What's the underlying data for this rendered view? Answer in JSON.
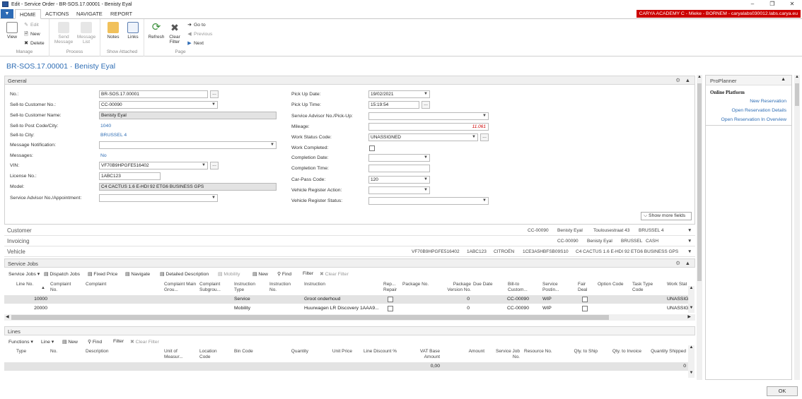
{
  "window": {
    "title": "Edit - Service Order - BR-SOS.17.00001 - Benisty Eyal"
  },
  "ribbon_tabs": [
    "HOME",
    "ACTIONS",
    "NAVIGATE",
    "REPORT"
  ],
  "company": "CARYA ACADEMY C - Mieke - BORNEM - caryalabs030012.labs.carya.eu",
  "ribbon": {
    "manage": {
      "label": "Manage",
      "view": "View",
      "edit": "Edit",
      "new": "New",
      "delete": "Delete"
    },
    "process": {
      "label": "Process",
      "send_message": "Send\nMessage",
      "message_list": "Message\nList"
    },
    "attached": {
      "label": "Show Attached",
      "notes": "Notes",
      "links": "Links"
    },
    "page": {
      "label": "Page",
      "refresh": "Refresh",
      "clear_filter": "Clear\nFilter",
      "goto": "Go to",
      "previous": "Previous",
      "next": "Next"
    }
  },
  "page_title": "BR-SOS.17.00001 · Benisty Eyal",
  "general": {
    "title": "General",
    "no_label": "No.:",
    "no": "BR-SOS.17.00001",
    "cust_no_label": "Sell-to Customer No.:",
    "cust_no": "CC-00090",
    "cust_name_label": "Sell-to Customer Name:",
    "cust_name": "Benisty Eyal",
    "post_label": "Sell-to Post Code/City:",
    "post": "1040",
    "city_label": "Sell-to City:",
    "city": "BRUSSEL 4",
    "msg_notif_label": "Message Notification:",
    "messages_label": "Messages:",
    "messages": "No",
    "vin_label": "VIN:",
    "vin": "VF70B9HPGFE516402",
    "license_label": "License No.:",
    "license": "1ABC123",
    "model_label": "Model:",
    "model": "C4 CACTUS 1.6 E-HDI 92 ETG6 BUSINESS  GPS",
    "sa_appt_label": "Service Advisor No./Appointment:",
    "pickup_date_label": "Pick Up Date:",
    "pickup_date": "19/02/2021",
    "pickup_time_label": "Pick Up Time:",
    "pickup_time": "15:19:54",
    "sa_pickup_label": "Service Advisor No./Pick-Up:",
    "mileage_label": "Mileage:",
    "mileage": "11.061",
    "work_status_label": "Work Status Code:",
    "work_status": "UNASSIGNED",
    "work_completed_label": "Work Completed:",
    "completion_date_label": "Completion Date:",
    "completion_time_label": "Completion Time:",
    "carpass_label": "Car-Pass Code:",
    "carpass": "120",
    "vr_action_label": "Vehicle Register Action:",
    "vr_status_label": "Vehicle Register Status:",
    "show_more": "Show more fields"
  },
  "fasttabs": {
    "customer": {
      "name": "Customer",
      "summary": [
        "CC-00090",
        "Benisty Eyal",
        "Toulousestraat 43",
        "BRUSSEL 4"
      ]
    },
    "invoicing": {
      "name": "Invoicing",
      "summary": [
        "CC-00090",
        "Benisty Eyal",
        "BRUSSEL",
        "CASH"
      ]
    },
    "vehicle": {
      "name": "Vehicle",
      "summary": [
        "VF70B9HPGFE516402",
        "1ABC123",
        "CITROËN",
        "1CE3A5HBFSB09S10",
        "C4 CACTUS 1.6 E-HDI 92 ETG6 BUSINESS  GPS"
      ]
    }
  },
  "service_jobs": {
    "title": "Service Jobs",
    "toolbar": [
      "Service Jobs",
      "Dispatch Jobs",
      "Fixed Price",
      "Navigate",
      "Detailed Description",
      "Mobility",
      "New",
      "Find",
      "Filter",
      "Clear Filter"
    ],
    "columns": [
      "Line No.",
      "Complaint No.",
      "Complaint",
      "Complaint Main Grou...",
      "Complaint Subgrou...",
      "Instruction Type",
      "Instruction No.",
      "Instruction",
      "Rep... Repair",
      "Package No.",
      "Package Version No.",
      "Due Date",
      "Bill-to Custom...",
      "Service Postin...",
      "Fair Deal",
      "Option Code",
      "Task Type Code",
      "Work Stat"
    ],
    "rows": [
      {
        "line": "10000",
        "itype": "Service",
        "instr": "Groot onderhoud",
        "pkgver": "0",
        "bill": "CC-00090",
        "post": "WIP",
        "status": "UNASSIGN"
      },
      {
        "line": "20000",
        "itype": "Mobility",
        "instr": "Huurwagen LR Discovery 1AAA9...",
        "pkgver": "0",
        "bill": "CC-00090",
        "post": "WIP",
        "status": "UNASSIGN"
      }
    ]
  },
  "lines": {
    "title": "Lines",
    "toolbar": [
      "Functions",
      "Line",
      "New",
      "Find",
      "Filter",
      "Clear Filter"
    ],
    "columns": [
      "Type",
      "No.",
      "Description",
      "Unit of Measur...",
      "Location Code",
      "Bin Code",
      "Quantity",
      "Unit Price",
      "Line Discount %",
      "VAT Base Amount",
      "Amount",
      "Service Job No.",
      "Resource No.",
      "Qty. to Ship",
      "Qty. to Invoice",
      "Quantity Shipped"
    ],
    "total_vat": "0,00",
    "total_shipped": "0"
  },
  "factbox": {
    "title": "ProPlanner",
    "heading": "Online Platform",
    "links": [
      "New Reservation",
      "Open Reservation Details",
      "Open Reservation In Overview"
    ]
  },
  "ok": "OK",
  "colors": {
    "accent": "#2e6db4",
    "company_bg": "#cc0000",
    "file_tab": "#2d6bb5"
  }
}
